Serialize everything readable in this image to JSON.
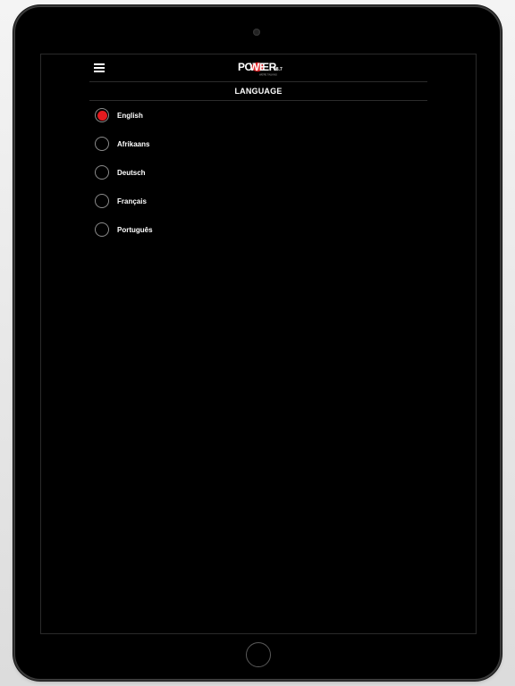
{
  "header": {
    "logo_text": "POWER",
    "logo_frequency": "98.7",
    "logo_tagline": "WE'RE TALKING"
  },
  "page": {
    "title": "LANGUAGE"
  },
  "languages": [
    {
      "label": "English",
      "selected": true
    },
    {
      "label": "Afrikaans",
      "selected": false
    },
    {
      "label": "Deutsch",
      "selected": false
    },
    {
      "label": "Français",
      "selected": false
    },
    {
      "label": "Português",
      "selected": false
    }
  ],
  "colors": {
    "accent": "#e31b1f",
    "background": "#000000",
    "text": "#ffffff"
  },
  "icons": {
    "menu": "hamburger-menu-icon",
    "radio_selected": "radio-selected",
    "radio_unselected": "radio-unselected"
  }
}
